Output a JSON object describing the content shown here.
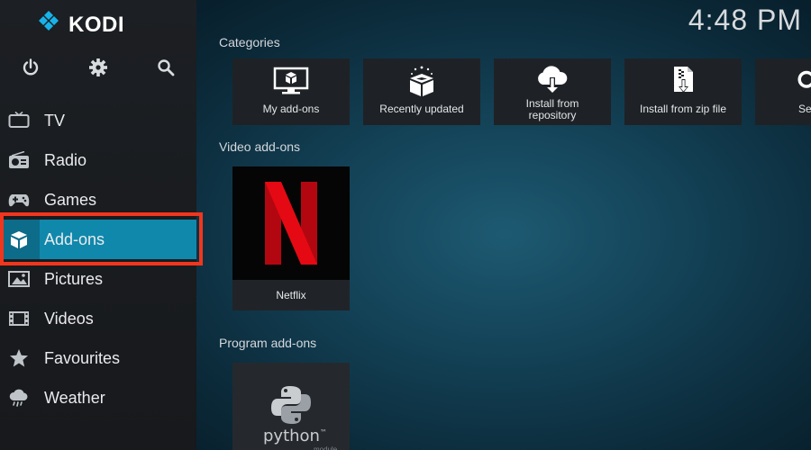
{
  "app": {
    "name": "KODI",
    "logo_icon": "kodi-logo-icon"
  },
  "clock": "4:48 PM",
  "top_icons": [
    "power-icon",
    "gear-icon",
    "search-icon"
  ],
  "sidebar": {
    "items": [
      {
        "label": "TV",
        "icon": "tv-icon"
      },
      {
        "label": "Radio",
        "icon": "radio-icon"
      },
      {
        "label": "Games",
        "icon": "gamepad-icon"
      },
      {
        "label": "Add-ons",
        "icon": "box-icon",
        "active": true
      },
      {
        "label": "Pictures",
        "icon": "picture-icon"
      },
      {
        "label": "Videos",
        "icon": "film-icon"
      },
      {
        "label": "Favourites",
        "icon": "star-icon"
      },
      {
        "label": "Weather",
        "icon": "cloud-icon"
      }
    ],
    "highlight_color": "#f1361d",
    "active_color": "#1088ab"
  },
  "categories": {
    "title": "Categories",
    "items": [
      {
        "label": "My add-ons",
        "icon": "monitor-box-icon"
      },
      {
        "label": "Recently updated",
        "icon": "open-box-icon"
      },
      {
        "label": "Install from repository",
        "label_line1": "Install from",
        "label_line2": "repository",
        "icon": "cloud-download-icon"
      },
      {
        "label": "Install from zip file",
        "icon": "zip-file-icon"
      },
      {
        "label": "Se",
        "icon": "settings-icon"
      }
    ]
  },
  "video_addons": {
    "title": "Video add-ons",
    "items": [
      {
        "label": "Netflix",
        "art_letter": "N",
        "art_color": "#e50914"
      }
    ]
  },
  "program_addons": {
    "title": "Program add-ons",
    "items": [
      {
        "art_text": "python",
        "art_sub": "module",
        "tm": "™"
      }
    ]
  }
}
